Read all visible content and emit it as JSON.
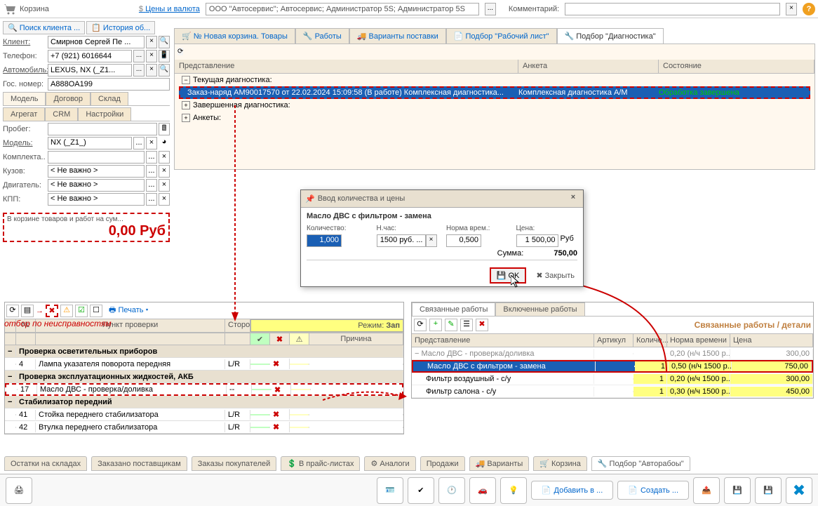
{
  "header": {
    "title": "Корзина",
    "prices_link": "Цены и валюта",
    "org": "OOO \"Автосервис\"; Автосервис; Администратор 5S; Администратор 5S",
    "comment_label": "Комментарий:"
  },
  "left_search": {
    "client_search": "Поиск клиента ...",
    "history": "История об..."
  },
  "client": {
    "labels": {
      "client": "Клиент:",
      "phone": "Телефон:",
      "car": "Автомобиль:",
      "gos": "Гос. номер:"
    },
    "name": "Смирнов Сергей Пе ...",
    "phone": "+7 (921) 6016644",
    "car": "LEXUS, NX (_Z1...",
    "gos": "A888OA199"
  },
  "left_tabs": [
    "Модель",
    "Договор",
    "Склад",
    "Агрегат",
    "CRM",
    "Настройки"
  ],
  "fields": {
    "probeg": {
      "lbl": "Пробег:",
      "val": ""
    },
    "model": {
      "lbl": "Модель:",
      "val": "NX (_Z1_)"
    },
    "kompl": {
      "lbl": "Комплекта..",
      "val": ""
    },
    "kuzov": {
      "lbl": "Кузов:",
      "val": "< Не важно >"
    },
    "dvig": {
      "lbl": "Двигатель:",
      "val": "< Не важно >"
    },
    "kpp": {
      "lbl": "КПП:",
      "val": "< Не важно >"
    }
  },
  "cart_total": {
    "lbl": "В корзине товаров и работ на сум...",
    "amount": "0,00 Руб"
  },
  "main_tabs": [
    "№ Новая корзина. Товары",
    "Работы",
    "Варианты поставки",
    "Подбор \"Рабочий лист\"",
    "Подбор \"Диагностика\""
  ],
  "grid": {
    "cols": [
      "Представление",
      "Анкета",
      "Состояние"
    ],
    "rows": [
      {
        "type": "group",
        "text": "Текущая диагностика:"
      },
      {
        "type": "selected",
        "col1": "Заказ-наряд AM90017570 от 22.02.2024 15:09:58 (В работе) Комплексная диагностика...",
        "col2": "Комплексная диагностика А/М",
        "col3": "Обработка завершена"
      },
      {
        "type": "group",
        "text": "Завершенная диагностика:"
      },
      {
        "type": "group",
        "text": "Анкеты:"
      }
    ]
  },
  "dialog": {
    "title": "Ввод количества и цены",
    "name": "Масло ДВС с фильтром - замена",
    "labels": {
      "qty": "Количество:",
      "nchas": "Н.час:",
      "norm": "Норма врем.:",
      "price": "Цена:",
      "sum": "Сумма:",
      "cur": "Руб"
    },
    "qty": "1,000",
    "nchas": "1500 руб. ...",
    "norm": "0,500",
    "price": "1 500,00",
    "sum": "750,00",
    "ok": "OK",
    "cancel": "Закрыть"
  },
  "red_note": "отбор по неисправностям",
  "check_grid": {
    "toolbar_print": "Печать",
    "hdr": {
      "num": "№",
      "point": "Пункт проверки",
      "side": "Сторона",
      "mode_label": "Режим:",
      "mode": "Зап",
      "reason": "Причина"
    },
    "rows": [
      {
        "type": "group",
        "text": "Проверка осветительных приборов"
      },
      {
        "num": "4",
        "text": "Лампа указателя поворота передняя",
        "side": "L/R",
        "bad": true
      },
      {
        "type": "group",
        "text": "Проверка эксплуатационных жидкостей, АКБ"
      },
      {
        "num": "17",
        "text": "Масло ДВС - проверка/доливка",
        "side": "--",
        "bad": true,
        "hl": true
      },
      {
        "type": "group",
        "text": "Стабилизатор передний"
      },
      {
        "num": "41",
        "text": "Стойка переднего стабилизатора",
        "side": "L/R",
        "bad": true
      },
      {
        "num": "42",
        "text": "Втулка переднего стабилизатора",
        "side": "L/R",
        "bad": true
      }
    ]
  },
  "right_panel": {
    "tabs": [
      "Связанные работы",
      "Включенные работы"
    ],
    "title": "Связанные работы / детали",
    "hdr": [
      "Представление",
      "Артикул",
      "Количе...",
      "Норма времени",
      "Цена"
    ],
    "rows": [
      {
        "dim": true,
        "name": "Масло ДВС - проверка/доливка",
        "qty": "",
        "norm": "0,20 (н/ч 1500 р...",
        "price": "300,00"
      },
      {
        "sel": true,
        "name": "Масло ДВС с фильтром - замена",
        "qty": "1",
        "norm": "0,50 (н/ч 1500 р...",
        "price": "750,00"
      },
      {
        "name": "Фильтр воздушный - с/у",
        "qty": "1",
        "norm": "0,20 (н/ч 1500 р...",
        "price": "300,00"
      },
      {
        "name": "Фильтр салона - с/у",
        "qty": "1",
        "norm": "0,30 (н/ч 1500 р...",
        "price": "450,00"
      }
    ]
  },
  "bottom_tabs": [
    "Остатки на складах",
    "Заказано поставщикам",
    "Заказы покупателей",
    "В прайс-листах",
    "Аналоги",
    "Продажи",
    "Варианты",
    "Корзина",
    "Подбор \"Авторабоы\""
  ],
  "bottom_bar": {
    "add": "Добавить в ...",
    "create": "Создать ..."
  }
}
